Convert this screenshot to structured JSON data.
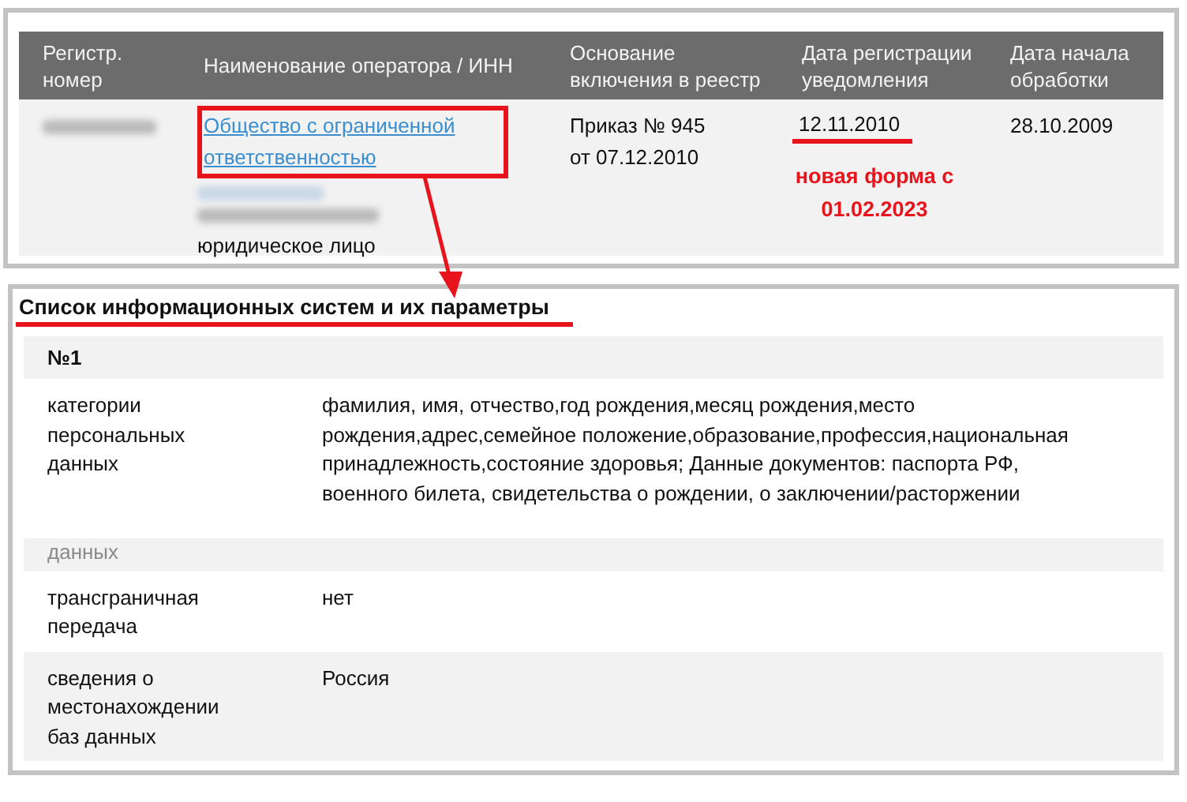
{
  "registry_table": {
    "columns": [
      "Регистр. номер",
      "Наименование оператора / ИНН",
      "Основание включения в реестр",
      "Дата регистрации уведомления",
      "Дата начала обработки"
    ],
    "row": {
      "reg_number_redacted": true,
      "operator_link": "Общество с ограниченной ответственностью",
      "operator_redacted": true,
      "operator_type": "юридическое лицо",
      "basis": "Приказ № 945 от 07.12.2010",
      "registration_date": "12.11.2010",
      "start_date": "28.10.2009"
    }
  },
  "annotation_note": "новая форма с 01.02.2023",
  "systems_panel": {
    "title": "Список информационных систем и их параметры",
    "system_number": "№1",
    "rows": [
      {
        "label": "категории персональных данных",
        "value": "фамилия, имя, отчество,год рождения,месяц рождения,место рождения,адрес,семейное положение,образование,профессия,национальная принадлежность,состояние здоровья; Данные документов: паспорта РФ, военного билета, свидетельства о рождении, о заключении/расторжении",
        "faded": false
      },
      {
        "label": "данных",
        "value": "",
        "faded": true
      },
      {
        "label": "трансграничная передача",
        "value": "нет",
        "faded": false
      },
      {
        "label": "сведения о местонахождении баз данных",
        "value": "Россия",
        "faded": false
      }
    ]
  }
}
